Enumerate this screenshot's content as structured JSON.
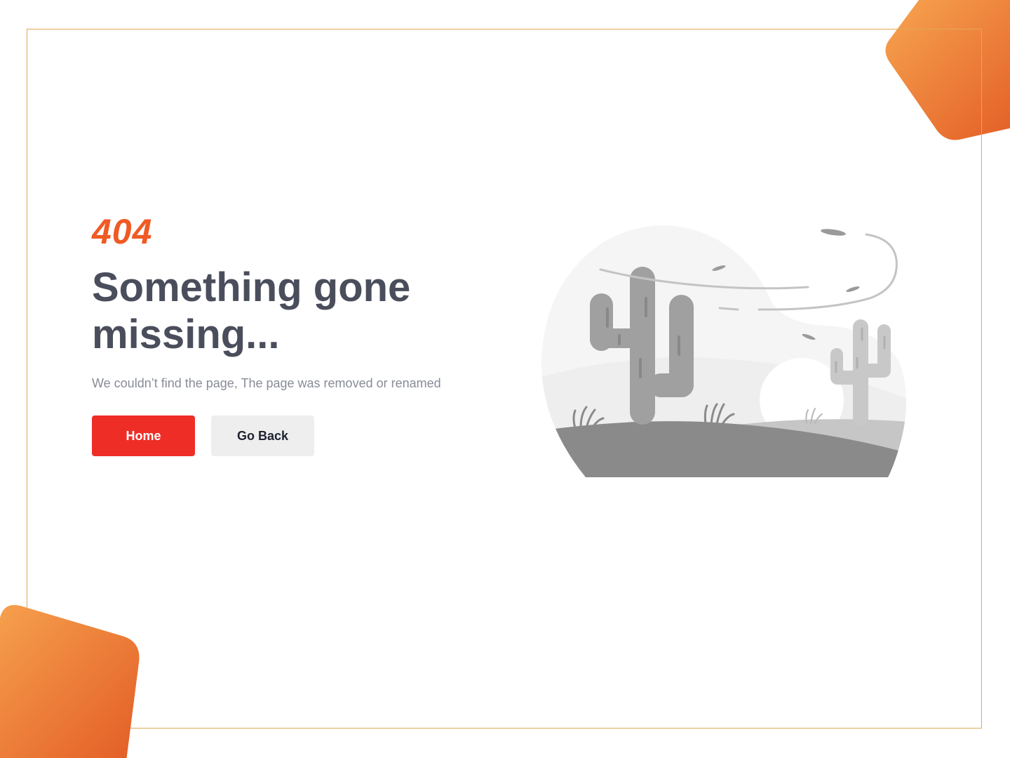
{
  "error": {
    "code": "404",
    "title": "Something gone missing...",
    "message": "We couldn’t find the page, The page was removed or renamed"
  },
  "actions": {
    "home_label": "Home",
    "back_label": "Go Back"
  },
  "colors": {
    "accent": "#f05a24",
    "primary_button": "#ef2d27",
    "secondary_button": "#eeeeee",
    "heading": "#4a4e5c",
    "subtext": "#888c98",
    "frame_border": "#e0a85a",
    "decor_gradient_start": "#f7a550",
    "decor_gradient_end": "#e25a24"
  },
  "illustration": {
    "icon": "desert-cactus-illustration"
  }
}
